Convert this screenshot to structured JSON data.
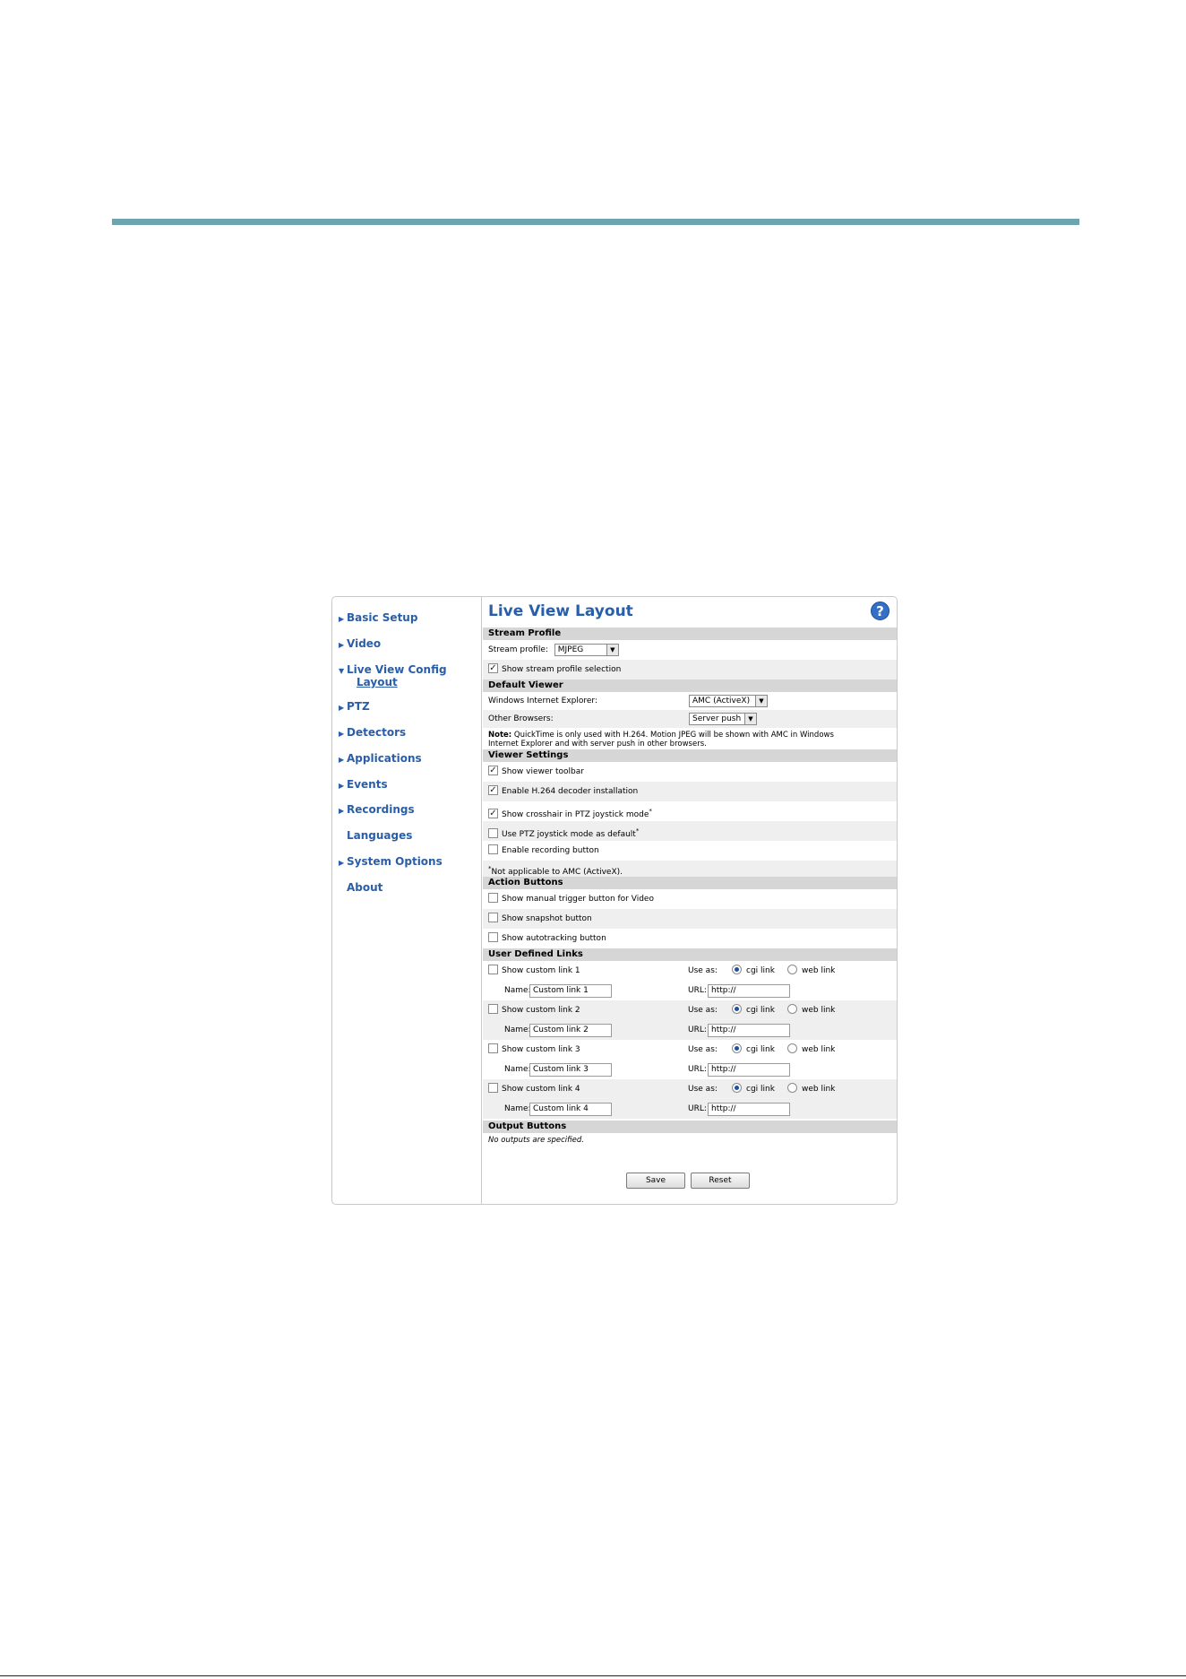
{
  "nav": {
    "basic_setup": "Basic Setup",
    "video": "Video",
    "live_view_config": "Live View Config",
    "layout": "Layout",
    "ptz": "PTZ",
    "detectors": "Detectors",
    "applications": "Applications",
    "events": "Events",
    "recordings": "Recordings",
    "languages": "Languages",
    "system_options": "System Options",
    "about": "About"
  },
  "page": {
    "title": "Live View Layout",
    "help": "?"
  },
  "stream_profile": {
    "header": "Stream Profile",
    "label": "Stream profile:",
    "value": "MJPEG",
    "show_selection_label": "Show stream profile selection",
    "show_selection_checked": true
  },
  "default_viewer": {
    "header": "Default Viewer",
    "ie_label": "Windows Internet Explorer:",
    "ie_value": "AMC (ActiveX)",
    "other_label": "Other Browsers:",
    "other_value": "Server push",
    "note_bold": "Note:",
    "note_line1": "QuickTime is only used with H.264. Motion JPEG will be shown with AMC in Windows",
    "note_line2": "Internet Explorer and with server push in other browsers."
  },
  "viewer_settings": {
    "header": "Viewer Settings",
    "items": [
      {
        "label": "Show viewer toolbar",
        "checked": true,
        "mark": "✓",
        "sup": ""
      },
      {
        "label": "Enable H.264 decoder installation",
        "checked": true,
        "mark": "✓",
        "sup": ""
      },
      {
        "label": "Show crosshair in PTZ joystick mode",
        "checked": true,
        "mark": "✓",
        "sup": "*"
      },
      {
        "label": "Use PTZ joystick mode as default",
        "checked": false,
        "mark": "",
        "sup": "*"
      },
      {
        "label": "Enable recording button",
        "checked": false,
        "mark": "",
        "sup": ""
      }
    ],
    "footnote_star": "*",
    "footnote": "Not applicable to AMC (ActiveX)."
  },
  "action_buttons": {
    "header": "Action Buttons",
    "items": [
      {
        "label": "Show manual trigger button for Video",
        "checked": false
      },
      {
        "label": "Show snapshot button",
        "checked": false
      },
      {
        "label": "Show autotracking button",
        "checked": false
      }
    ]
  },
  "user_links": {
    "header": "User Defined Links",
    "use_as_label": "Use as:",
    "cgi_label": "cgi link",
    "web_label": "web link",
    "name_label": "Name:",
    "url_label": "URL:",
    "links": [
      {
        "show_label": "Show custom link 1",
        "name": "Custom link 1",
        "url": "http://",
        "use_as": "cgi"
      },
      {
        "show_label": "Show custom link 2",
        "name": "Custom link 2",
        "url": "http://",
        "use_as": "cgi"
      },
      {
        "show_label": "Show custom link 3",
        "name": "Custom link 3",
        "url": "http://",
        "use_as": "cgi"
      },
      {
        "show_label": "Show custom link 4",
        "name": "Custom link 4",
        "url": "http://",
        "use_as": "cgi"
      }
    ]
  },
  "output_buttons": {
    "header": "Output Buttons",
    "empty_text": "No outputs are specified."
  },
  "buttons": {
    "save": "Save",
    "reset": "Reset"
  }
}
